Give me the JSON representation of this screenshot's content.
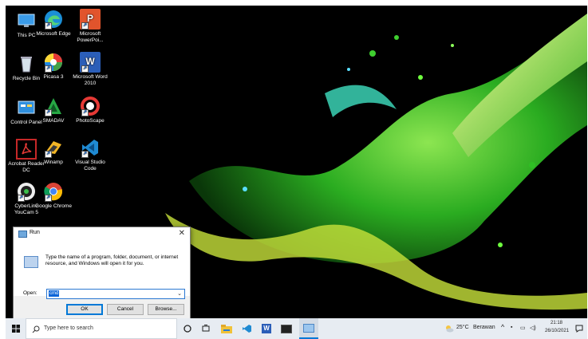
{
  "desktop": {
    "icons": [
      {
        "label": "This PC",
        "icon": "this-pc-icon"
      },
      {
        "label": "Microsoft Edge",
        "icon": "edge-icon"
      },
      {
        "label": "Microsoft PowerPoi...",
        "icon": "powerpoint-icon"
      },
      {
        "label": "Recycle Bin",
        "icon": "recycle-bin-icon"
      },
      {
        "label": "Picasa 3",
        "icon": "picasa-icon"
      },
      {
        "label": "Microsoft Word 2010",
        "icon": "word-icon"
      },
      {
        "label": "Control Panel",
        "icon": "control-panel-icon"
      },
      {
        "label": "SMADAV",
        "icon": "smadav-icon"
      },
      {
        "label": "PhotoScape",
        "icon": "photoscape-icon"
      },
      {
        "label": "Acrobat Reader DC",
        "icon": "acrobat-icon"
      },
      {
        "label": "Winamp",
        "icon": "winamp-icon"
      },
      {
        "label": "Visual Studio Code",
        "icon": "vscode-icon"
      },
      {
        "label": "CyberLink YouCam 5",
        "icon": "youcam-icon"
      },
      {
        "label": "Google Chrome",
        "icon": "chrome-icon"
      }
    ]
  },
  "run_dialog": {
    "title": "Run",
    "description": "Type the name of a program, folder, document, or internet resource, and Windows will open it for you.",
    "open_label": "Open:",
    "open_value": "cmd",
    "ok_label": "OK",
    "cancel_label": "Cancel",
    "browse_label": "Browse..."
  },
  "taskbar": {
    "search_placeholder": "Type here to search",
    "weather_temp": "25°C",
    "weather_text": "Berawan",
    "time": "21:18",
    "date": "26/10/2021"
  },
  "colors": {
    "taskbar_bg": "#e7ecf2",
    "accent": "#0078d7",
    "wallpaper_bg": "#000000",
    "splash_green": "#3dcc2a",
    "splash_yellow": "#e8f060"
  }
}
